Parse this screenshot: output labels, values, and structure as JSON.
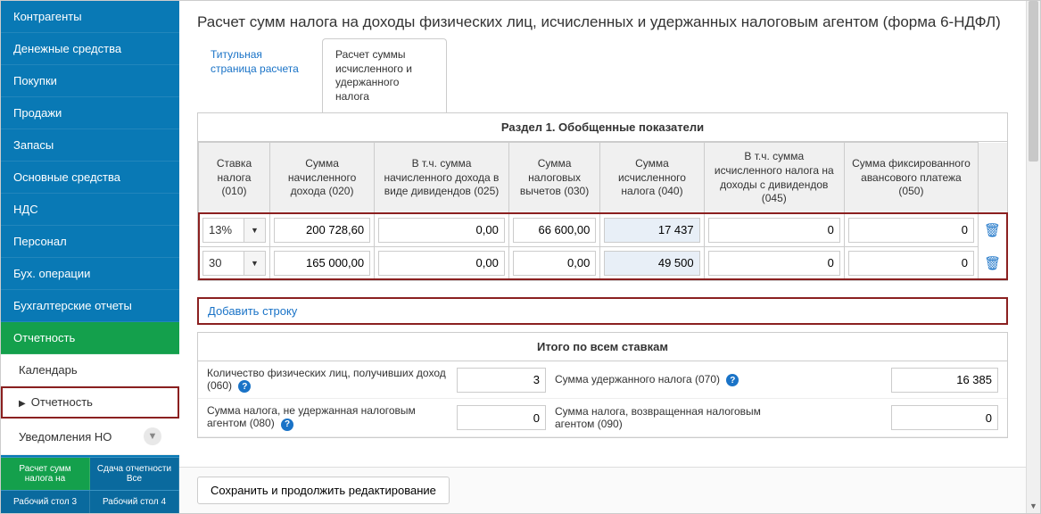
{
  "sidebar": {
    "items": [
      {
        "label": "Контрагенты"
      },
      {
        "label": "Денежные средства"
      },
      {
        "label": "Покупки"
      },
      {
        "label": "Продажи"
      },
      {
        "label": "Запасы"
      },
      {
        "label": "Основные средства"
      },
      {
        "label": "НДС"
      },
      {
        "label": "Персонал"
      },
      {
        "label": "Бух. операции"
      },
      {
        "label": "Бухгалтерские отчеты"
      },
      {
        "label": "Отчетность"
      }
    ],
    "sub_items": [
      {
        "label": "Календарь"
      },
      {
        "label": "Отчетность"
      },
      {
        "label": "Уведомления НО"
      }
    ],
    "bottom_tabs_row1": [
      {
        "label": "Расчет сумм налога на"
      },
      {
        "label": "Сдача отчетности Все"
      }
    ],
    "bottom_tabs_row2": [
      {
        "label": "Рабочий стол 3"
      },
      {
        "label": "Рабочий стол 4"
      }
    ]
  },
  "header": {
    "title": "Расчет сумм налога на доходы физических лиц, исчисленных и удержанных налоговым агентом (форма 6-НДФЛ)"
  },
  "content_tabs": [
    {
      "label": "Титульная страница расчета"
    },
    {
      "label": "Расчет суммы исчисленного и удержанного налога"
    }
  ],
  "section1": {
    "title": "Раздел 1. Обобщенные показатели",
    "columns": [
      "Ставка налога (010)",
      "Сумма начисленного дохода (020)",
      "В т.ч. сумма начисленного дохода в виде дивидендов (025)",
      "Сумма налоговых вычетов (030)",
      "Сумма исчисленного налога (040)",
      "В т.ч. сумма исчисленного налога на доходы с дивидендов (045)",
      "Сумма фиксированного авансового платежа (050)"
    ],
    "rows": [
      {
        "rate": "13%",
        "c020": "200 728,60",
        "c025": "0,00",
        "c030": "66 600,00",
        "c040": "17 437",
        "c045": "0",
        "c050": "0"
      },
      {
        "rate": "30",
        "c020": "165 000,00",
        "c025": "0,00",
        "c030": "0,00",
        "c040": "49 500",
        "c045": "0",
        "c050": "0"
      }
    ],
    "add_row": "Добавить строку"
  },
  "totals": {
    "title": "Итого по всем ставкам",
    "row1_label1": "Количество физических лиц, получивших доход (060)",
    "row1_val1": "3",
    "row1_label2": "Сумма удержанного налога (070)",
    "row1_val2": "16 385",
    "row2_label1": "Сумма налога, не удержанная налоговым агентом (080)",
    "row2_val1": "0",
    "row2_label2": "Сумма налога, возвращенная налоговым агентом (090)",
    "row2_val2": "0"
  },
  "bottom": {
    "save": "Сохранить и продолжить редактирование"
  }
}
